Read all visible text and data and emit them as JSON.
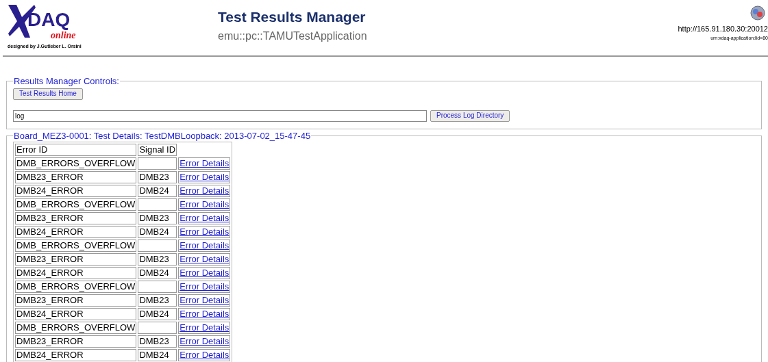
{
  "logo": {
    "word": "DAQ",
    "tagline": "online",
    "credit": "designed by J.Gutleber L. Orsini"
  },
  "header": {
    "title": "Test Results Manager",
    "subtitle": "emu::pc::TAMUTestApplication",
    "url": "http://165.91.180.30:20012",
    "urn": "urn:xdaq-application:lid=80"
  },
  "controls": {
    "legend": "Results Manager Controls:",
    "home_button": "Test Results Home",
    "directory": {
      "value": "log"
    },
    "process_button": "Process Log Directory"
  },
  "details": {
    "legend": "Board_MEZ3-0001: Test Details: TestDMBLoopback: 2013-07-02_15-47-45",
    "table": {
      "columns": [
        "Error ID",
        "Signal ID"
      ],
      "rows": [
        {
          "error_id": "DMB_ERRORS_OVERFLOW",
          "signal_id": "",
          "link": "Error Details"
        },
        {
          "error_id": "DMB23_ERROR",
          "signal_id": "DMB23",
          "link": "Error Details"
        },
        {
          "error_id": "DMB24_ERROR",
          "signal_id": "DMB24",
          "link": "Error Details"
        },
        {
          "error_id": "DMB_ERRORS_OVERFLOW",
          "signal_id": "",
          "link": "Error Details"
        },
        {
          "error_id": "DMB23_ERROR",
          "signal_id": "DMB23",
          "link": "Error Details"
        },
        {
          "error_id": "DMB24_ERROR",
          "signal_id": "DMB24",
          "link": "Error Details"
        },
        {
          "error_id": "DMB_ERRORS_OVERFLOW",
          "signal_id": "",
          "link": "Error Details"
        },
        {
          "error_id": "DMB23_ERROR",
          "signal_id": "DMB23",
          "link": "Error Details"
        },
        {
          "error_id": "DMB24_ERROR",
          "signal_id": "DMB24",
          "link": "Error Details"
        },
        {
          "error_id": "DMB_ERRORS_OVERFLOW",
          "signal_id": "",
          "link": "Error Details"
        },
        {
          "error_id": "DMB23_ERROR",
          "signal_id": "DMB23",
          "link": "Error Details"
        },
        {
          "error_id": "DMB24_ERROR",
          "signal_id": "DMB24",
          "link": "Error Details"
        },
        {
          "error_id": "DMB_ERRORS_OVERFLOW",
          "signal_id": "",
          "link": "Error Details"
        },
        {
          "error_id": "DMB23_ERROR",
          "signal_id": "DMB23",
          "link": "Error Details"
        },
        {
          "error_id": "DMB24_ERROR",
          "signal_id": "DMB24",
          "link": "Error Details"
        }
      ]
    }
  }
}
